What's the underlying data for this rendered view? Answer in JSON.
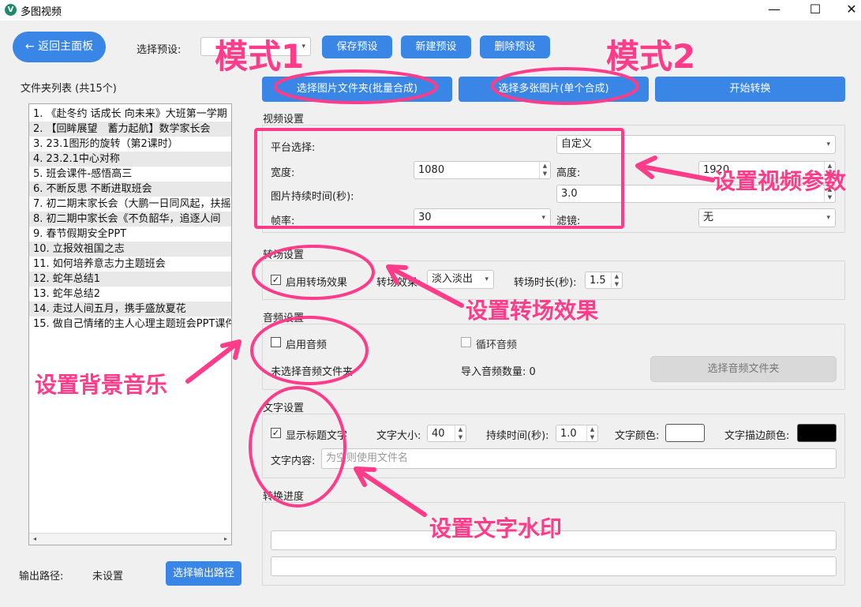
{
  "window": {
    "title": "多图视频",
    "app_icon": "V",
    "minimize": "—",
    "maximize": "☐",
    "close": "✕"
  },
  "toolbar": {
    "back_button": "← 返回主面板",
    "preset_label": "选择预设:",
    "preset_value": "",
    "save_preset": "保存预设",
    "new_preset": "新建预设",
    "delete_preset": "删除预设"
  },
  "folder_list": {
    "title": "文件夹列表 (共15个)",
    "items": [
      "1. 《赴冬约 话成长 向未来》大班第一学期",
      "2. 【回眸展望　蓄力起航】数学家长会",
      "3. 23.1图形的旋转（第2课时）",
      "4. 23.2.1中心对称",
      "5. 班会课件-感悟高三",
      "6. 不断反思 不断进取班会",
      "7. 初二期末家长会（大鹏一日同风起，扶摇",
      "8. 初二期中家长会《不负韶华，追逐人间",
      "9. 春节假期安全PPT",
      "10. 立报效祖国之志",
      "11. 如何培养意志力主题班会",
      "12. 蛇年总结1",
      "13. 蛇年总结2",
      "14. 走过人间五月，携手盛放夏花",
      "15. 做自己情绪的主人心理主题班会PPT课件"
    ]
  },
  "output": {
    "label": "输出路径:",
    "value": "未设置",
    "button": "选择输出路径"
  },
  "actions": {
    "select_folder": "选择图片文件夹(批量合成)",
    "select_images": "选择多张图片(单个合成)",
    "start": "开始转换"
  },
  "video_settings": {
    "title": "视频设置",
    "platform_label": "平台选择:",
    "platform_value": "自定义",
    "width_label": "宽度:",
    "width_value": "1080",
    "height_label": "高度:",
    "height_value": "1920",
    "duration_label": "图片持续时间(秒):",
    "duration_value": "3.0",
    "fps_label": "帧率:",
    "fps_value": "30",
    "filter_label": "滤镜:",
    "filter_value": "无"
  },
  "transition_settings": {
    "title": "转场设置",
    "enable_label": "启用转场效果",
    "enabled_mark": "✓",
    "effect_label": "转场效果:",
    "effect_value": "淡入淡出",
    "duration_label": "转场时长(秒):",
    "duration_value": "1.5"
  },
  "audio_settings": {
    "title": "音频设置",
    "enable_label": "启用音频",
    "loop_label": "循环音频",
    "status": "未选择音频文件夹",
    "count_label": "导入音频数量: 0",
    "select_button": "选择音频文件夹"
  },
  "text_settings": {
    "title": "文字设置",
    "show_title_label": "显示标题文字",
    "checked_mark": "✓",
    "size_label": "文字大小:",
    "size_value": "40",
    "duration_label": "持续时间(秒):",
    "duration_value": "1.0",
    "color_label": "文字颜色:",
    "color": "#ffffff",
    "stroke_label": "文字描边颜色:",
    "stroke_color": "#000000",
    "content_label": "文字内容:",
    "content_placeholder": "为空则使用文件名"
  },
  "progress": {
    "title": "转换进度"
  },
  "annotations": {
    "mode1": "模式1",
    "mode2": "模式2",
    "video_params": "设置视频参数",
    "transition": "设置转场效果",
    "music": "设置背景音乐",
    "watermark": "设置文字水印"
  },
  "colors": {
    "accent": "#3a86e6",
    "annotation": "#ff3c8a"
  }
}
